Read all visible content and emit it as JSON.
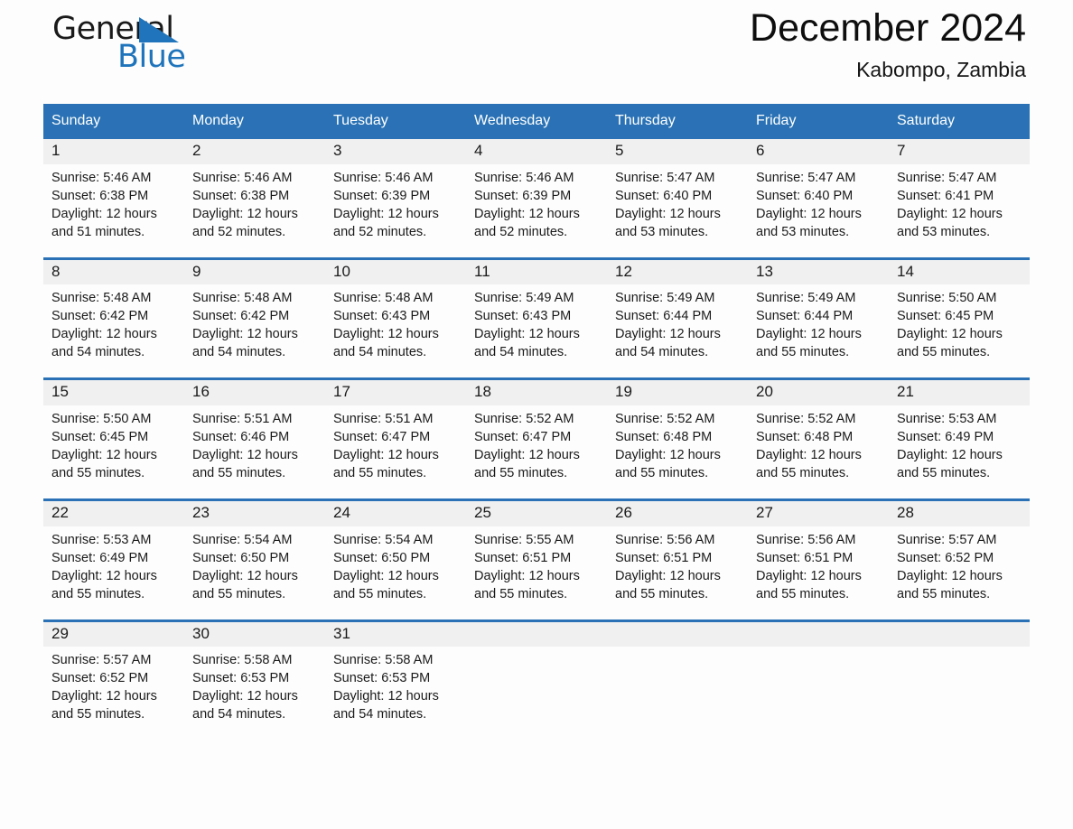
{
  "brand": {
    "word1": "General",
    "word2": "Blue",
    "triangle_color": "#1f74bb"
  },
  "header": {
    "title": "December 2024",
    "location": "Kabompo, Zambia"
  },
  "theme": {
    "header_blue": "#2a72b5",
    "daynum_bg": "#f0f0f0",
    "page_bg": "#fdfdfd",
    "text": "#1a1a1a"
  },
  "calendar": {
    "weekday_headers": [
      "Sunday",
      "Monday",
      "Tuesday",
      "Wednesday",
      "Thursday",
      "Friday",
      "Saturday"
    ],
    "weeks": [
      [
        {
          "day": "1",
          "sunrise": "Sunrise: 5:46 AM",
          "sunset": "Sunset: 6:38 PM",
          "daylight_l1": "Daylight: 12 hours",
          "daylight_l2": "and 51 minutes."
        },
        {
          "day": "2",
          "sunrise": "Sunrise: 5:46 AM",
          "sunset": "Sunset: 6:38 PM",
          "daylight_l1": "Daylight: 12 hours",
          "daylight_l2": "and 52 minutes."
        },
        {
          "day": "3",
          "sunrise": "Sunrise: 5:46 AM",
          "sunset": "Sunset: 6:39 PM",
          "daylight_l1": "Daylight: 12 hours",
          "daylight_l2": "and 52 minutes."
        },
        {
          "day": "4",
          "sunrise": "Sunrise: 5:46 AM",
          "sunset": "Sunset: 6:39 PM",
          "daylight_l1": "Daylight: 12 hours",
          "daylight_l2": "and 52 minutes."
        },
        {
          "day": "5",
          "sunrise": "Sunrise: 5:47 AM",
          "sunset": "Sunset: 6:40 PM",
          "daylight_l1": "Daylight: 12 hours",
          "daylight_l2": "and 53 minutes."
        },
        {
          "day": "6",
          "sunrise": "Sunrise: 5:47 AM",
          "sunset": "Sunset: 6:40 PM",
          "daylight_l1": "Daylight: 12 hours",
          "daylight_l2": "and 53 minutes."
        },
        {
          "day": "7",
          "sunrise": "Sunrise: 5:47 AM",
          "sunset": "Sunset: 6:41 PM",
          "daylight_l1": "Daylight: 12 hours",
          "daylight_l2": "and 53 minutes."
        }
      ],
      [
        {
          "day": "8",
          "sunrise": "Sunrise: 5:48 AM",
          "sunset": "Sunset: 6:42 PM",
          "daylight_l1": "Daylight: 12 hours",
          "daylight_l2": "and 54 minutes."
        },
        {
          "day": "9",
          "sunrise": "Sunrise: 5:48 AM",
          "sunset": "Sunset: 6:42 PM",
          "daylight_l1": "Daylight: 12 hours",
          "daylight_l2": "and 54 minutes."
        },
        {
          "day": "10",
          "sunrise": "Sunrise: 5:48 AM",
          "sunset": "Sunset: 6:43 PM",
          "daylight_l1": "Daylight: 12 hours",
          "daylight_l2": "and 54 minutes."
        },
        {
          "day": "11",
          "sunrise": "Sunrise: 5:49 AM",
          "sunset": "Sunset: 6:43 PM",
          "daylight_l1": "Daylight: 12 hours",
          "daylight_l2": "and 54 minutes."
        },
        {
          "day": "12",
          "sunrise": "Sunrise: 5:49 AM",
          "sunset": "Sunset: 6:44 PM",
          "daylight_l1": "Daylight: 12 hours",
          "daylight_l2": "and 54 minutes."
        },
        {
          "day": "13",
          "sunrise": "Sunrise: 5:49 AM",
          "sunset": "Sunset: 6:44 PM",
          "daylight_l1": "Daylight: 12 hours",
          "daylight_l2": "and 55 minutes."
        },
        {
          "day": "14",
          "sunrise": "Sunrise: 5:50 AM",
          "sunset": "Sunset: 6:45 PM",
          "daylight_l1": "Daylight: 12 hours",
          "daylight_l2": "and 55 minutes."
        }
      ],
      [
        {
          "day": "15",
          "sunrise": "Sunrise: 5:50 AM",
          "sunset": "Sunset: 6:45 PM",
          "daylight_l1": "Daylight: 12 hours",
          "daylight_l2": "and 55 minutes."
        },
        {
          "day": "16",
          "sunrise": "Sunrise: 5:51 AM",
          "sunset": "Sunset: 6:46 PM",
          "daylight_l1": "Daylight: 12 hours",
          "daylight_l2": "and 55 minutes."
        },
        {
          "day": "17",
          "sunrise": "Sunrise: 5:51 AM",
          "sunset": "Sunset: 6:47 PM",
          "daylight_l1": "Daylight: 12 hours",
          "daylight_l2": "and 55 minutes."
        },
        {
          "day": "18",
          "sunrise": "Sunrise: 5:52 AM",
          "sunset": "Sunset: 6:47 PM",
          "daylight_l1": "Daylight: 12 hours",
          "daylight_l2": "and 55 minutes."
        },
        {
          "day": "19",
          "sunrise": "Sunrise: 5:52 AM",
          "sunset": "Sunset: 6:48 PM",
          "daylight_l1": "Daylight: 12 hours",
          "daylight_l2": "and 55 minutes."
        },
        {
          "day": "20",
          "sunrise": "Sunrise: 5:52 AM",
          "sunset": "Sunset: 6:48 PM",
          "daylight_l1": "Daylight: 12 hours",
          "daylight_l2": "and 55 minutes."
        },
        {
          "day": "21",
          "sunrise": "Sunrise: 5:53 AM",
          "sunset": "Sunset: 6:49 PM",
          "daylight_l1": "Daylight: 12 hours",
          "daylight_l2": "and 55 minutes."
        }
      ],
      [
        {
          "day": "22",
          "sunrise": "Sunrise: 5:53 AM",
          "sunset": "Sunset: 6:49 PM",
          "daylight_l1": "Daylight: 12 hours",
          "daylight_l2": "and 55 minutes."
        },
        {
          "day": "23",
          "sunrise": "Sunrise: 5:54 AM",
          "sunset": "Sunset: 6:50 PM",
          "daylight_l1": "Daylight: 12 hours",
          "daylight_l2": "and 55 minutes."
        },
        {
          "day": "24",
          "sunrise": "Sunrise: 5:54 AM",
          "sunset": "Sunset: 6:50 PM",
          "daylight_l1": "Daylight: 12 hours",
          "daylight_l2": "and 55 minutes."
        },
        {
          "day": "25",
          "sunrise": "Sunrise: 5:55 AM",
          "sunset": "Sunset: 6:51 PM",
          "daylight_l1": "Daylight: 12 hours",
          "daylight_l2": "and 55 minutes."
        },
        {
          "day": "26",
          "sunrise": "Sunrise: 5:56 AM",
          "sunset": "Sunset: 6:51 PM",
          "daylight_l1": "Daylight: 12 hours",
          "daylight_l2": "and 55 minutes."
        },
        {
          "day": "27",
          "sunrise": "Sunrise: 5:56 AM",
          "sunset": "Sunset: 6:51 PM",
          "daylight_l1": "Daylight: 12 hours",
          "daylight_l2": "and 55 minutes."
        },
        {
          "day": "28",
          "sunrise": "Sunrise: 5:57 AM",
          "sunset": "Sunset: 6:52 PM",
          "daylight_l1": "Daylight: 12 hours",
          "daylight_l2": "and 55 minutes."
        }
      ],
      [
        {
          "day": "29",
          "sunrise": "Sunrise: 5:57 AM",
          "sunset": "Sunset: 6:52 PM",
          "daylight_l1": "Daylight: 12 hours",
          "daylight_l2": "and 55 minutes."
        },
        {
          "day": "30",
          "sunrise": "Sunrise: 5:58 AM",
          "sunset": "Sunset: 6:53 PM",
          "daylight_l1": "Daylight: 12 hours",
          "daylight_l2": "and 54 minutes."
        },
        {
          "day": "31",
          "sunrise": "Sunrise: 5:58 AM",
          "sunset": "Sunset: 6:53 PM",
          "daylight_l1": "Daylight: 12 hours",
          "daylight_l2": "and 54 minutes."
        },
        {
          "day": "",
          "sunrise": "",
          "sunset": "",
          "daylight_l1": "",
          "daylight_l2": ""
        },
        {
          "day": "",
          "sunrise": "",
          "sunset": "",
          "daylight_l1": "",
          "daylight_l2": ""
        },
        {
          "day": "",
          "sunrise": "",
          "sunset": "",
          "daylight_l1": "",
          "daylight_l2": ""
        },
        {
          "day": "",
          "sunrise": "",
          "sunset": "",
          "daylight_l1": "",
          "daylight_l2": ""
        }
      ]
    ]
  }
}
